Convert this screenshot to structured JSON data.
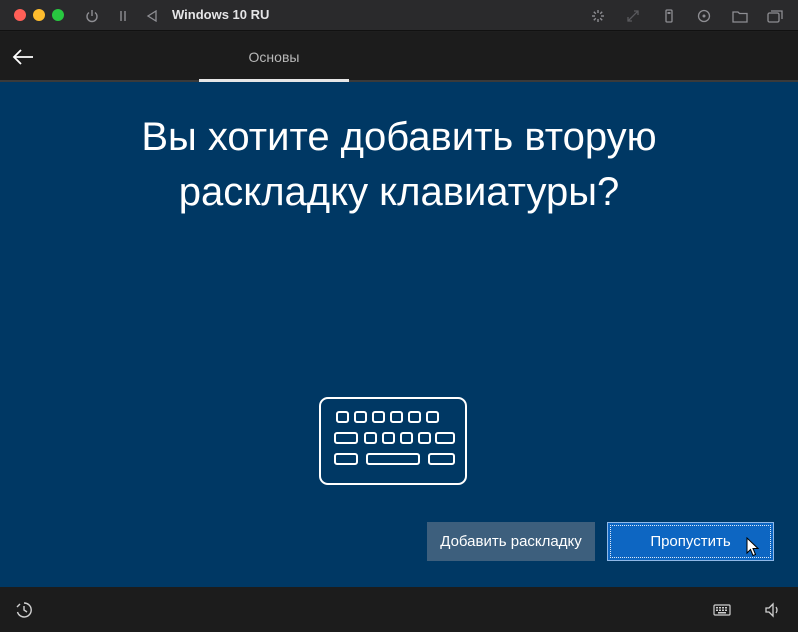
{
  "window": {
    "title": "Windows 10 RU",
    "colors": {
      "close": "#ff5f57",
      "minimize": "#febc2e",
      "zoom": "#28c840"
    },
    "toolbar_icons": [
      "power-icon",
      "pause-icon",
      "back-triangle-icon",
      "brightness-icon",
      "resize-icon",
      "usb-icon",
      "disc-icon",
      "folder-icon",
      "windows-icon"
    ]
  },
  "oobe": {
    "header": {
      "active_tab": "Основы"
    },
    "heading": "Вы хотите добавить вторую раскладку клавиатуры?",
    "buttons": {
      "add_layout": "Добавить раскладку",
      "skip": "Пропустить"
    },
    "colors": {
      "background": "#003864",
      "primary_button": "#0d66c2",
      "secondary_button": "#3d5f7d"
    },
    "footer_icons": [
      "accessibility-icon",
      "keyboard-icon",
      "volume-icon"
    ]
  }
}
